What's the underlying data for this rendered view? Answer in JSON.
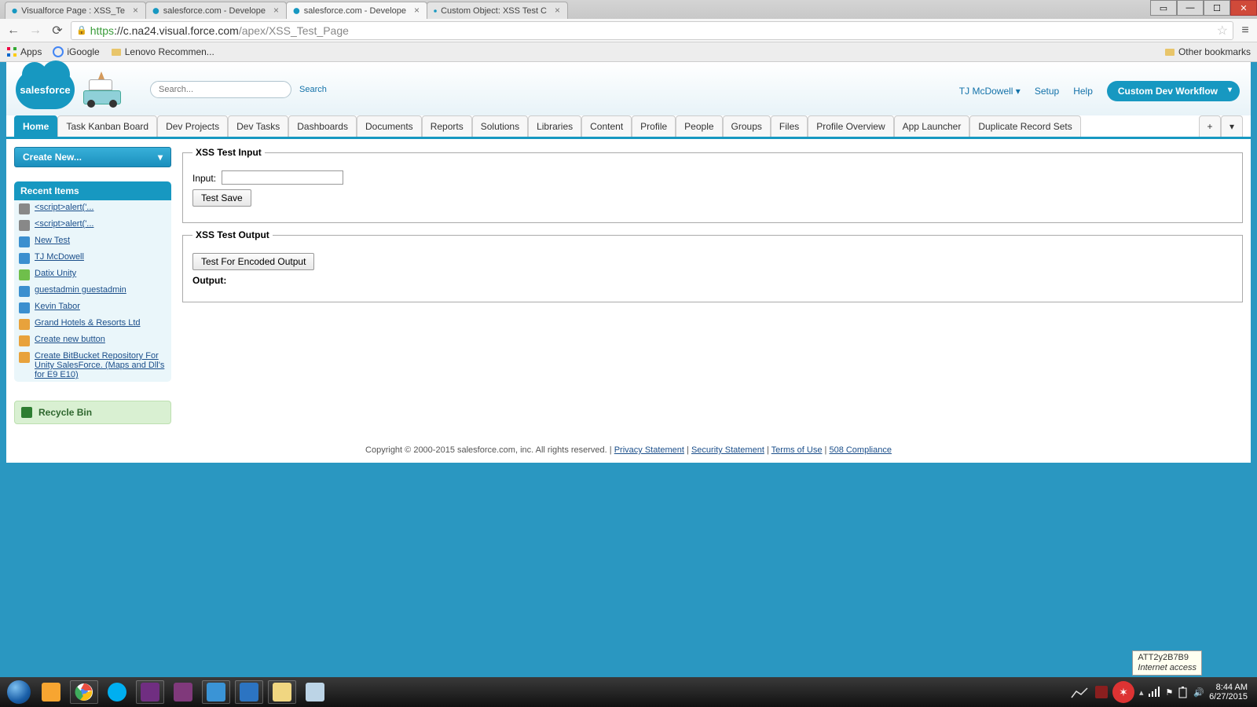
{
  "browser": {
    "tabs": [
      {
        "title": "Visualforce Page : XSS_Te",
        "active": false
      },
      {
        "title": "salesforce.com - Develope",
        "active": false
      },
      {
        "title": "salesforce.com - Develope",
        "active": true
      },
      {
        "title": "Custom Object: XSS Test C",
        "active": false
      }
    ],
    "url_proto": "https",
    "url_host": "://c.na24.visual.force.com",
    "url_path": "/apex/XSS_Test_Page",
    "bookmarks": {
      "apps": "Apps",
      "igoogle": "iGoogle",
      "lenovo": "Lenovo Recommen...",
      "other": "Other bookmarks"
    }
  },
  "header": {
    "logo_text": "salesforce",
    "search_placeholder": "Search...",
    "search_btn": "Search",
    "user": "TJ McDowell",
    "setup": "Setup",
    "help": "Help",
    "app_menu": "Custom Dev Workflow"
  },
  "tabs": [
    "Home",
    "Task Kanban Board",
    "Dev Projects",
    "Dev Tasks",
    "Dashboards",
    "Documents",
    "Reports",
    "Solutions",
    "Libraries",
    "Content",
    "Profile",
    "People",
    "Groups",
    "Files",
    "Profile Overview",
    "App Launcher",
    "Duplicate Record Sets"
  ],
  "sidebar": {
    "create": "Create New...",
    "recent_header": "Recent Items",
    "items": [
      {
        "label": "<script>alert('...",
        "color": "#888"
      },
      {
        "label": "<script>alert('...",
        "color": "#888"
      },
      {
        "label": "New Test",
        "color": "#3b8fcf"
      },
      {
        "label": "TJ McDowell",
        "color": "#3b8fcf"
      },
      {
        "label": "Datix Unity",
        "color": "#6fbf4b"
      },
      {
        "label": "guestadmin guestadmin",
        "color": "#3b8fcf"
      },
      {
        "label": "Kevin Tabor",
        "color": "#3b8fcf"
      },
      {
        "label": "Grand Hotels & Resorts Ltd",
        "color": "#e8a23c"
      },
      {
        "label": "Create new button",
        "color": "#e8a23c"
      },
      {
        "label": "Create BitBucket Repository For Unity SalesForce. (Maps and Dll's for E9 E10)",
        "color": "#e8a23c"
      }
    ],
    "recycle": "Recycle Bin"
  },
  "main": {
    "fs1": "XSS Test Input",
    "input_label": "Input:",
    "input_value": "",
    "save_btn": "Test Save",
    "fs2": "XSS Test Output",
    "encode_btn": "Test For Encoded Output",
    "output_label": "Output:"
  },
  "footer": {
    "copyright": "Copyright © 2000-2015 salesforce.com, inc. All rights reserved. | ",
    "links": [
      "Privacy Statement",
      "Security Statement",
      "Terms of Use",
      "508 Compliance"
    ]
  },
  "tray": {
    "tooltip_name": "ATT2y2B7B9",
    "tooltip_sub": "Internet access",
    "time": "8:44 AM",
    "date": "6/27/2015"
  }
}
